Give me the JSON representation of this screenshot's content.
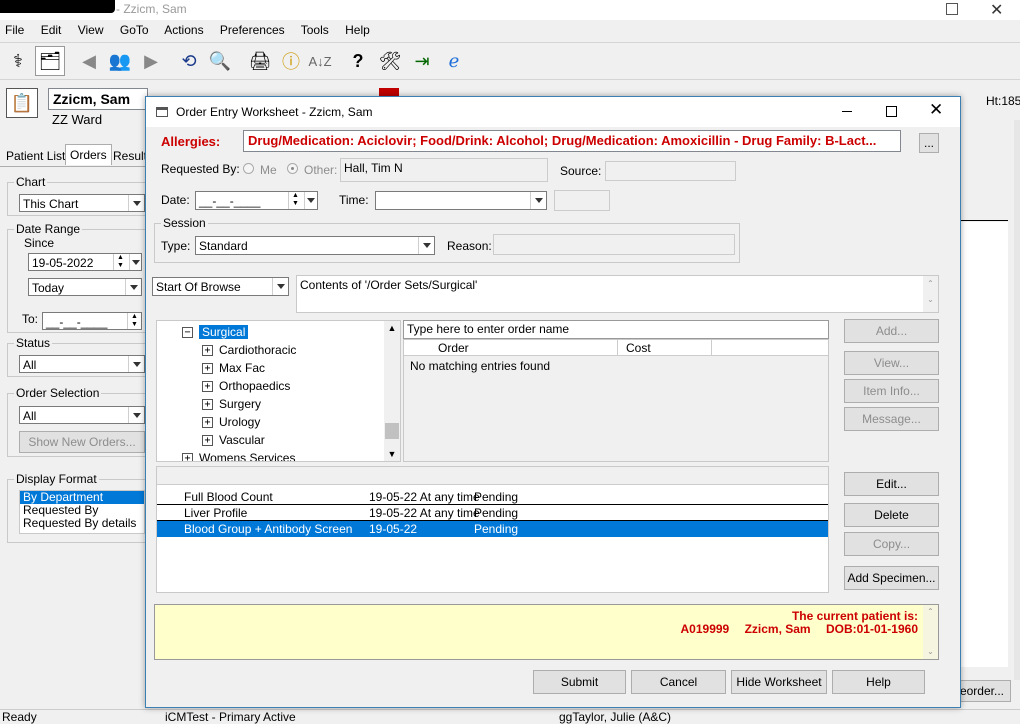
{
  "app": {
    "title": "- Zzicm, Sam",
    "menu": [
      "File",
      "Edit",
      "View",
      "GoTo",
      "Actions",
      "Preferences",
      "Tools",
      "Help"
    ],
    "patient_name": "Zzicm, Sam",
    "ward": "ZZ Ward",
    "right_header": "Ht:185",
    "tabs": [
      "Patient List",
      "Orders",
      "Results"
    ],
    "chart_label": "Chart",
    "chart_value": "This Chart",
    "date_range_label": "Date Range",
    "since_label": "Since",
    "since_value": "19-05-2022",
    "today_value": "Today",
    "to_label": "To:",
    "to_value": "__-__-____",
    "status_label": "Status",
    "status_value": "All",
    "order_selection_label": "Order Selection",
    "order_selection_value": "All",
    "show_new_orders": "Show New Orders...",
    "display_format_label": "Display Format",
    "display_format_items": [
      "By Department",
      "Requested By",
      "Requested By details"
    ],
    "reorder_button": "Reorder...",
    "status_bar": [
      "Ready",
      "iCMTest - Primary Active",
      "ggTaylor, Julie  (A&C)"
    ]
  },
  "dialog": {
    "title": "Order Entry Worksheet - Zzicm, Sam",
    "allergies_label": "Allergies:",
    "allergies_text": "Drug/Medication: Aciclovir; Food/Drink: Alcohol; Drug/Medication: Amoxicillin - Drug Family: B-Lact...",
    "ellipsis_btn": "...",
    "requested_by_label": "Requested By:",
    "me_label": "Me",
    "other_label": "Other:",
    "requested_by_value": "Hall, Tim N",
    "source_label": "Source:",
    "date_label": "Date:",
    "date_value": "__-__-____",
    "time_label": "Time:",
    "session_label": "Session",
    "type_label": "Type:",
    "type_value": "Standard",
    "reason_label": "Reason:",
    "browse_value": "Start Of Browse",
    "contents_text": "Contents of '/Order Sets/Surgical'",
    "tree": {
      "root": "Surgical",
      "children": [
        "Cardiothoracic",
        "Max Fac",
        "Orthopaedics",
        "Surgery",
        "Urology",
        "Vascular"
      ],
      "sibling": "Womens Services"
    },
    "search_placeholder": "Type here to enter order name",
    "order_col": "Order",
    "cost_col": "Cost",
    "no_entries": "No matching entries found",
    "side_buttons": [
      "Add...",
      "View...",
      "Item Info...",
      "Message..."
    ],
    "worklist": [
      {
        "name": "Full Blood Count",
        "date": "19-05-22 At any time",
        "status": "Pending"
      },
      {
        "name": "Liver Profile",
        "date": "19-05-22 At any time",
        "status": "Pending"
      },
      {
        "name": "Blood Group + Antibody Screen",
        "date": "19-05-22",
        "status": "Pending"
      }
    ],
    "worklist_buttons": [
      "Edit...",
      "Delete",
      "Copy...",
      "Add Specimen..."
    ],
    "current_patient_label": "The current patient is:",
    "patient_id": "A019999",
    "patient_name": "Zzicm, Sam",
    "dob": "DOB:01-01-1960",
    "footer_buttons": [
      "Submit",
      "Cancel",
      "Hide Worksheet",
      "Help"
    ]
  },
  "colors": {
    "selection": "#0078d7",
    "allergy_red": "#cc0000",
    "info_yellow": "#ffffcc"
  }
}
